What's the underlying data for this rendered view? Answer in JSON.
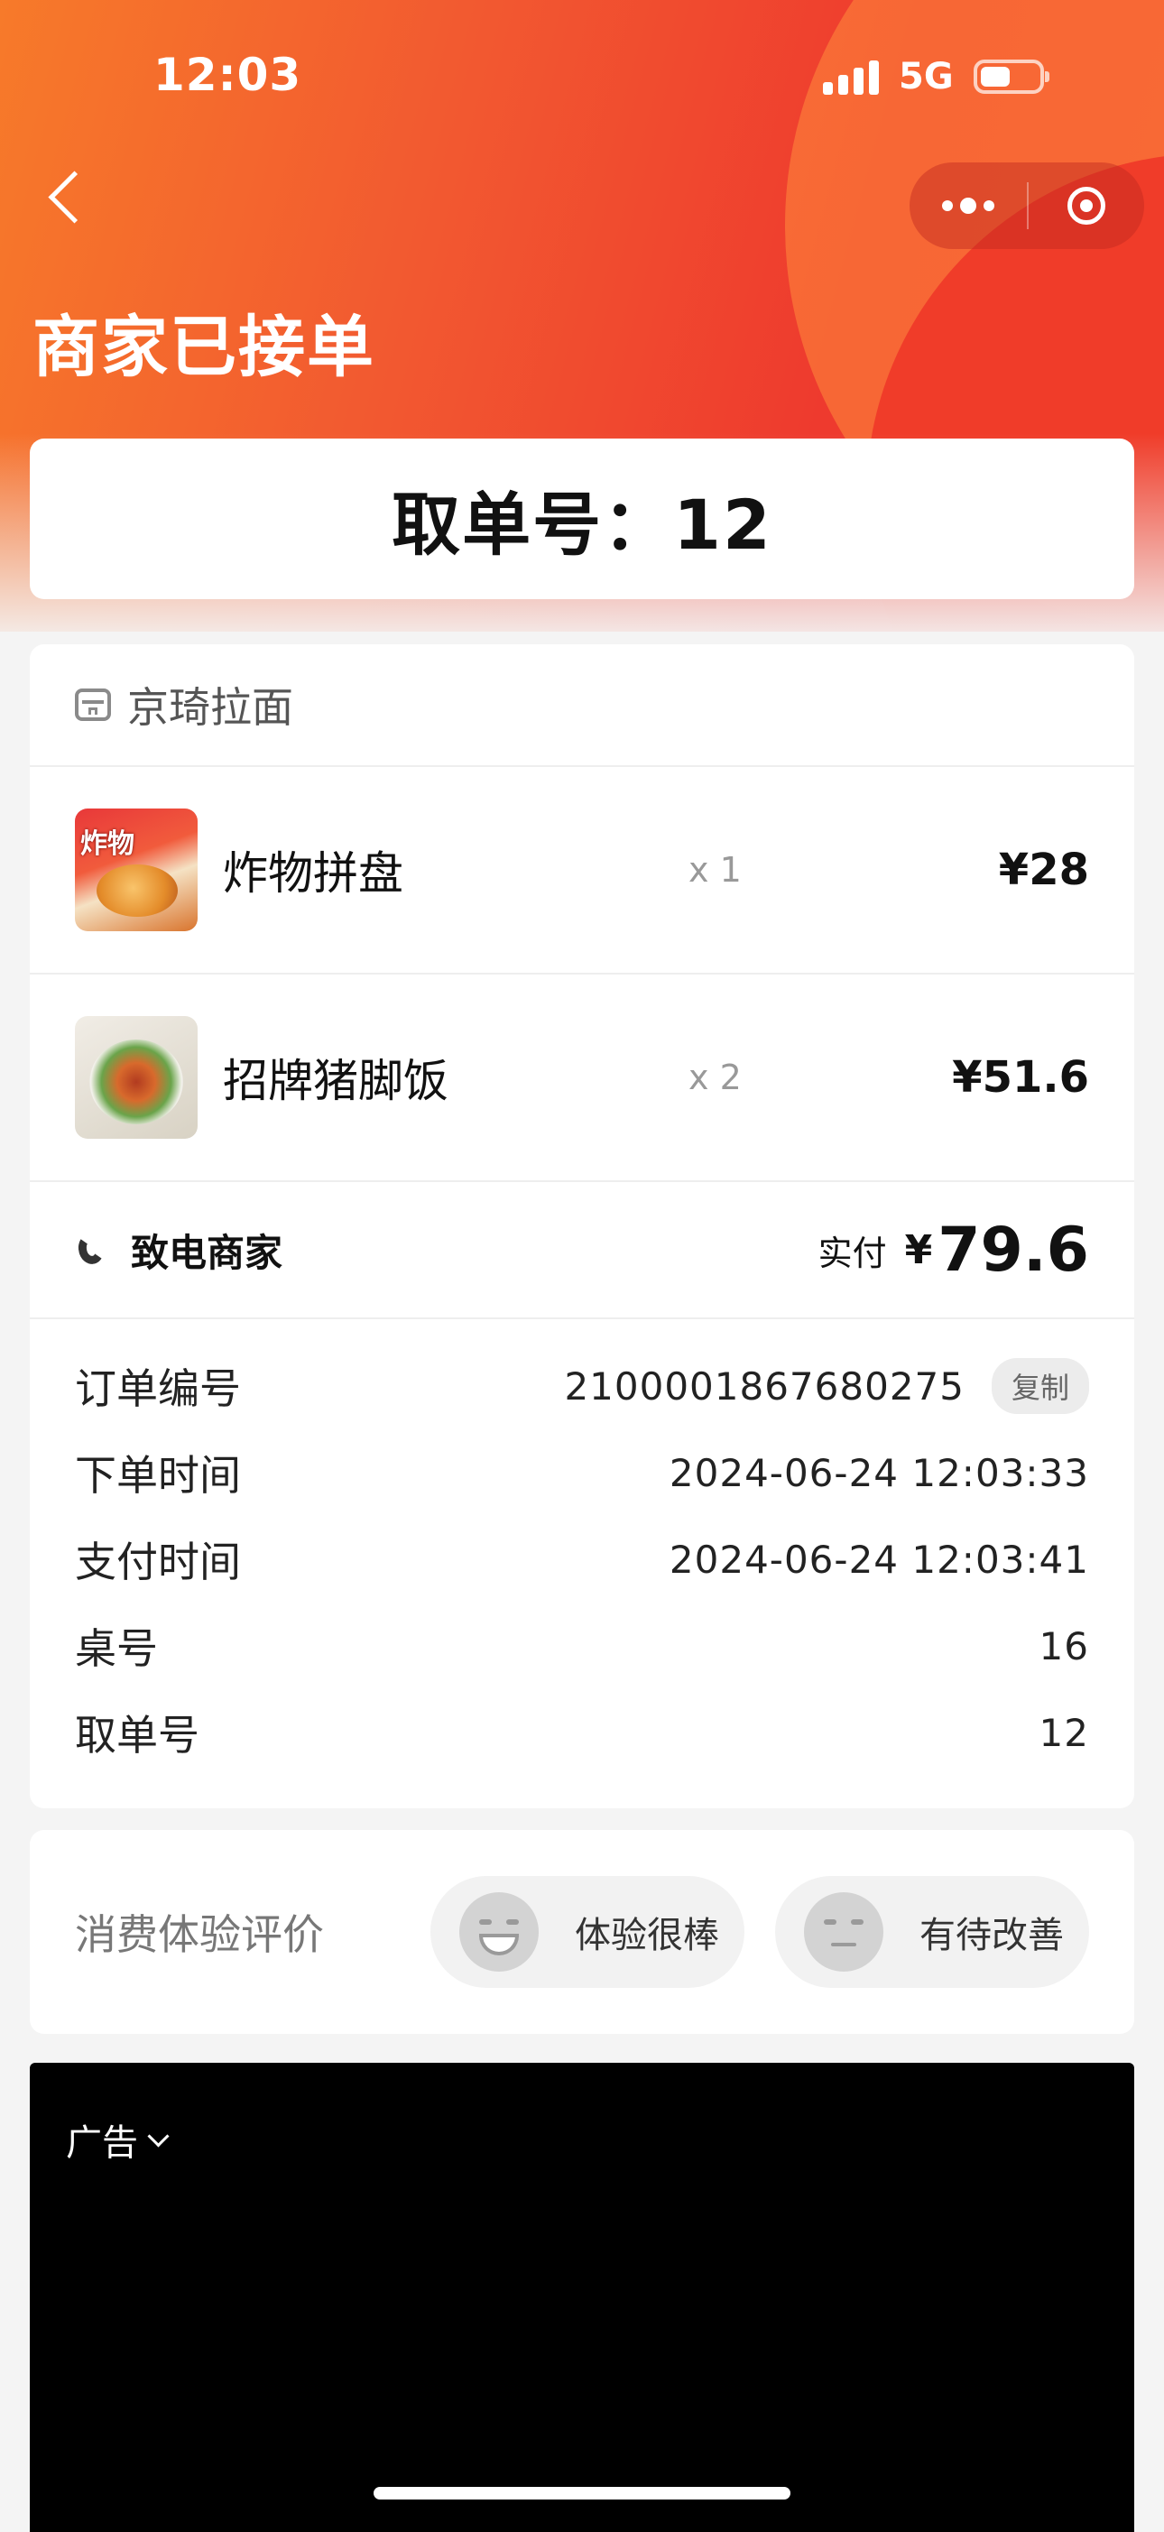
{
  "status_bar": {
    "time": "12:03",
    "network": "5G"
  },
  "header": {
    "title": "商家已接单"
  },
  "pickup": {
    "text": "取单号：12"
  },
  "shop": {
    "name": "京琦拉面"
  },
  "items": [
    {
      "name": "炸物拼盘",
      "qty": "x 1",
      "price": "¥28",
      "thumb_label": "炸物"
    },
    {
      "name": "招牌猪脚饭",
      "qty": "x 2",
      "price": "¥51.6"
    }
  ],
  "summary": {
    "call_label": "致电商家",
    "paid_label": "实付",
    "currency": "¥",
    "amount": "79.6"
  },
  "details": [
    {
      "label": "订单编号",
      "value": "2100001867680275"
    },
    {
      "label": "下单时间",
      "value": "2024-06-24 12:03:33"
    },
    {
      "label": "支付时间",
      "value": "2024-06-24 12:03:41"
    },
    {
      "label": "桌号",
      "value": "16"
    },
    {
      "label": "取单号",
      "value": "12"
    }
  ],
  "copy_label": "复制",
  "rating": {
    "label": "消费体验评价",
    "good": "体验很棒",
    "bad": "有待改善"
  },
  "ad": {
    "label": "广告"
  },
  "colors": {
    "header_start": "#f77a2a",
    "header_end": "#ee3a2e"
  }
}
